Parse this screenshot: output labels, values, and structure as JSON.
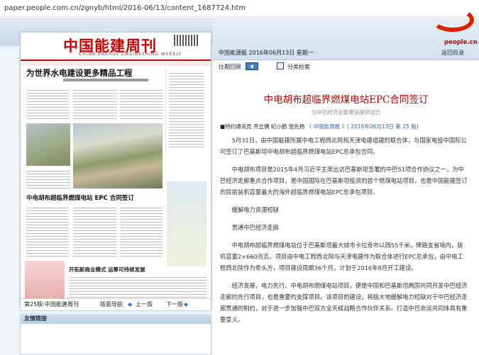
{
  "browser": {
    "url": "paper.people.com.cn/zgnyb/html/2016-06/13/content_1687724.htm"
  },
  "newspaper": {
    "masthead": "中国能建周刊",
    "masthead_en": "CHINA ENERGY ENGINEERING WEEKLY",
    "headline": "为世界水电建设更多精品工程",
    "headline2": "中电胡布超临界燃煤电站 EPC 合同签订",
    "headline3": "开拓新商业模式 运筹可持续发展"
  },
  "page_nav": {
    "page_label": "第25版:中国能建周刊",
    "layout_nav": "版面导航",
    "prev": "上一版",
    "next": "下一版"
  },
  "links": {
    "title": "友情链接"
  },
  "header": {
    "edition": "中国能源报 2016年06月13日 星期一",
    "logo_url": "people.cn",
    "back_link": "返回目录"
  },
  "toolbar": {
    "prev_label": "往期回顾",
    "search_label": "分类检索"
  },
  "article": {
    "title": "中电胡布超临界燃煤电站EPC合同签订",
    "subtitle": "为中巴经济走廊建设提供动力",
    "byline_prefix": "■特约通讯员 齐立偶 纪小鹤 张先扬",
    "byline_source": "《 中国能源报 》( 2016年06月13日 第 25 版)",
    "paragraphs": [
      "5月31日，由中国能建所属中电工程西北院和天津电建组建的联合体，与国家电投中国际公司签订了巴基斯坦中电胡布超临界燃煤电站EPC总承包合同。",
      "中电胡布项目是2015年4月习近平主席出访巴基斯坦签署的中巴51项合作协议之一，为中巴经济走廊重点合作项目，是中国国际在巴基斯坦投资的首个燃煤电站项目，也是中国能建签订的目前装机容量最大的海外超临界燃煤电站EPC总承包项目。",
      "缓解电力资源短缺",
      "贯通中巴经济走廊",
      "中电胡布超临界燃煤电站位于巴基斯坦最大城市卡拉奇市以西55千米，俾路支省境内，装机容量2×660兆瓦。项目由中电工程西北院与天津电建作为联合体进行EPC总承包，由中电工程西北院作为牵头方，项目建设周期36个月，计划于2016年8月开工建设。",
      "经济发展，电力先行。中电胡布燃煤电站项目，便是中国和巴基斯坦两国共同开发中巴经济走廊的先行项目，也是重要的支撑项目。该项目的建设，将极大地缓解电力短缺对于中巴经济走廊贯通的制约，对于进一步加强中巴双方全天候战略合作伙伴关系、打造中巴命运共同体具有重要意义。"
    ]
  }
}
